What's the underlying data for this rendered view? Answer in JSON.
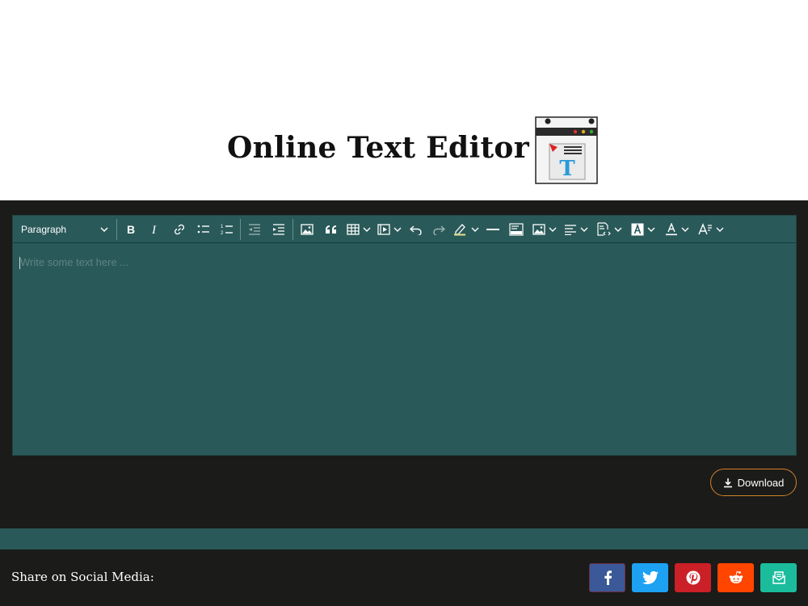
{
  "header": {
    "title": "Online Text Editor",
    "logo_letter": "T"
  },
  "editor": {
    "block_format": "Paragraph",
    "placeholder": "Write some text here ...",
    "toolbar": [
      {
        "name": "bold-button",
        "icon": "bold-icon"
      },
      {
        "name": "italic-button",
        "icon": "italic-icon"
      },
      {
        "name": "link-button",
        "icon": "link-icon"
      },
      {
        "name": "bulleted-list-button",
        "icon": "bulleted-list-icon"
      },
      {
        "name": "numbered-list-button",
        "icon": "numbered-list-icon"
      },
      {
        "name": "outdent-button",
        "icon": "outdent-icon"
      },
      {
        "name": "indent-button",
        "icon": "indent-icon"
      },
      {
        "name": "insert-image-button",
        "icon": "image-icon"
      },
      {
        "name": "block-quote-button",
        "icon": "quote-icon"
      },
      {
        "name": "insert-table-button",
        "icon": "table-icon"
      },
      {
        "name": "insert-media-button",
        "icon": "media-icon"
      },
      {
        "name": "undo-button",
        "icon": "undo-icon"
      },
      {
        "name": "redo-button",
        "icon": "redo-icon"
      },
      {
        "name": "highlight-button",
        "icon": "highlight-icon"
      },
      {
        "name": "horizontal-line-button",
        "icon": "horizontal-line-icon"
      },
      {
        "name": "html-embed-button",
        "icon": "html-embed-icon"
      },
      {
        "name": "image-style-button",
        "icon": "image-icon"
      },
      {
        "name": "alignment-button",
        "icon": "align-left-icon"
      },
      {
        "name": "source-editing-button",
        "icon": "source-icon"
      },
      {
        "name": "font-background-color-button",
        "icon": "font-background-icon"
      },
      {
        "name": "font-color-button",
        "icon": "font-color-icon"
      },
      {
        "name": "font-size-button",
        "icon": "font-size-icon"
      }
    ]
  },
  "actions": {
    "download_label": "Download"
  },
  "footer": {
    "share_label": "Share on Social Media:",
    "social": [
      {
        "name": "facebook",
        "color": "#3b5998"
      },
      {
        "name": "twitter",
        "color": "#1da1f2"
      },
      {
        "name": "pinterest",
        "color": "#cb2027"
      },
      {
        "name": "reddit",
        "color": "#ff4500"
      },
      {
        "name": "email",
        "color": "#1abc9c"
      }
    ]
  },
  "colors": {
    "editor_bg": "#2a5959",
    "dark_bg": "#1b1b19",
    "download_border": "#d4822a"
  }
}
